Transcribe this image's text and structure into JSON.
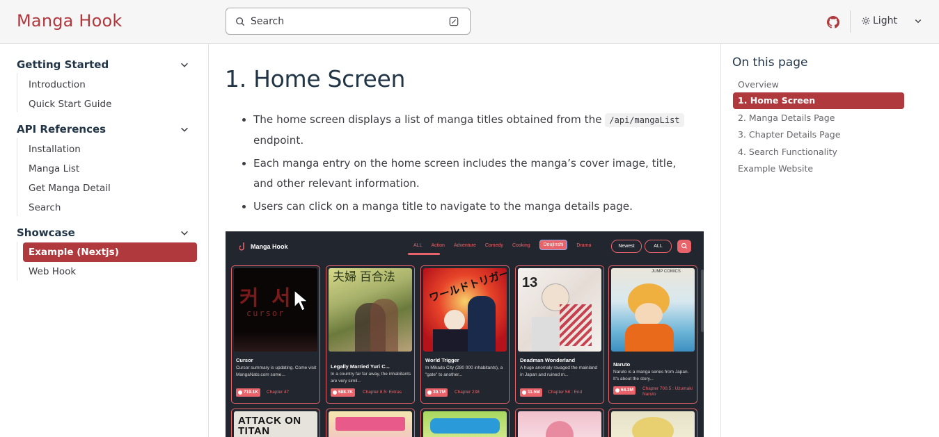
{
  "header": {
    "logo": "Manga Hook",
    "search_label": "Search",
    "theme_label": "Light"
  },
  "sidebar": {
    "sections": [
      {
        "title": "Getting Started",
        "items": [
          "Introduction",
          "Quick Start Guide"
        ]
      },
      {
        "title": "API References",
        "items": [
          "Installation",
          "Manga List",
          "Get Manga Detail",
          "Search"
        ]
      },
      {
        "title": "Showcase",
        "items": [
          "Example (Nextjs)",
          "Web Hook"
        ],
        "active": "Example (Nextjs)"
      }
    ]
  },
  "main": {
    "heading": "1. Home Screen",
    "bullet1_pre": "The home screen displays a list of manga titles obtained from the",
    "bullet1_code": "/api/mangaList",
    "bullet1_post": "endpoint.",
    "bullet2": "Each manga entry on the home screen includes the manga’s cover image, title, and other relevant information.",
    "bullet3": "Users can click on a manga title to navigate to the manga details page."
  },
  "screenshot": {
    "app_name": "Manga Hook",
    "tabs": [
      "ALL",
      "Action",
      "Adventure",
      "Comedy",
      "Cooking",
      "Doujinshi",
      "Drama"
    ],
    "active_tab": "ALL",
    "highlighted_tab": "Doujinshi",
    "sort_button": "Newest",
    "filter_button": "ALL",
    "cards": [
      {
        "title": "Cursor",
        "desc": "Cursor summary is updating. Come visit MangaNato.com some...",
        "views": "719.1K",
        "chapter": "Chapter 47",
        "cover_text": "커 서",
        "cover_sub": "cursor"
      },
      {
        "title": "Legally Married Yuri C...",
        "desc": "In a country far far away, the inhabitants are very simil...",
        "views": "588.7K",
        "chapter": "Chapter 8.5: Extras",
        "cover_text": "夫婦 百合法"
      },
      {
        "title": "World Trigger",
        "desc": "In Mikado City (280 000 inhabitants), a \"gate\" to another...",
        "views": "30.7M",
        "chapter": "Chapter 238",
        "cover_text": "ワールドトリガー"
      },
      {
        "title": "Deadman Wonderland",
        "desc": "A huge anomaly ravaged the mainland in Japan and ruined m...",
        "views": "11.5M",
        "chapter": "Chapter 58 : End",
        "cover_text": "13"
      },
      {
        "title": "Naruto",
        "desc": "Naruto is a manga series from Japan. It's about the story...",
        "views": "64.3M",
        "chapter": "Chapter 700.5 : Uzumaki Naruto",
        "cover_text": "JUMP COMICS"
      }
    ],
    "row2_covers": [
      "ATTACK ON TITAN",
      "",
      "",
      "",
      ""
    ]
  },
  "toc": {
    "title": "On this page",
    "items": [
      "Overview",
      "1. Home Screen",
      "2. Manga Details Page",
      "3. Chapter Details Page",
      "4. Search Functionality",
      "Example Website"
    ],
    "active": "1. Home Screen"
  },
  "colors": {
    "brand": "#b0393e",
    "screenshot_bg": "#22262f",
    "screenshot_accent": "#e8646a"
  }
}
